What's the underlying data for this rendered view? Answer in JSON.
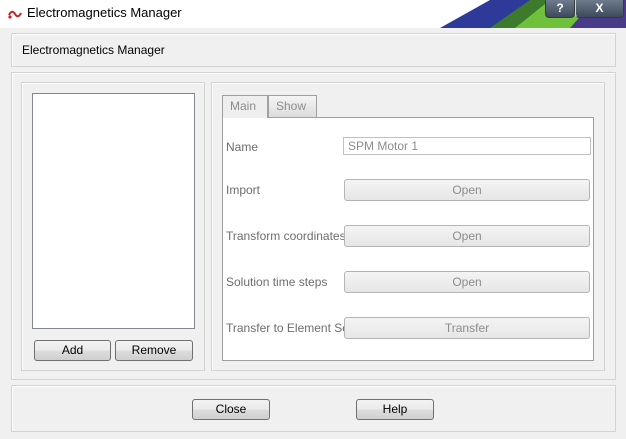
{
  "window": {
    "title": "Electromagnetics Manager",
    "help_button": "?",
    "close_button": "X"
  },
  "header": {
    "label": "Electromagnetics Manager"
  },
  "list": {
    "add_label": "Add",
    "remove_label": "Remove"
  },
  "tabs": [
    {
      "label": "Main"
    },
    {
      "label": "Show"
    }
  ],
  "form": {
    "name_label": "Name",
    "name_value": "SPM Motor 1",
    "import_label": "Import",
    "import_button": "Open",
    "transform_label": "Transform coordinates",
    "transform_button": "Open",
    "solution_label": "Solution time steps",
    "solution_button": "Open",
    "transfer_label": "Transfer to Element Set",
    "transfer_button": "Transfer"
  },
  "footer": {
    "close_label": "Close",
    "help_label": "Help"
  },
  "colors": {
    "accent_window": "#3c4a5b",
    "disabled_text": "#8c8c8c"
  }
}
